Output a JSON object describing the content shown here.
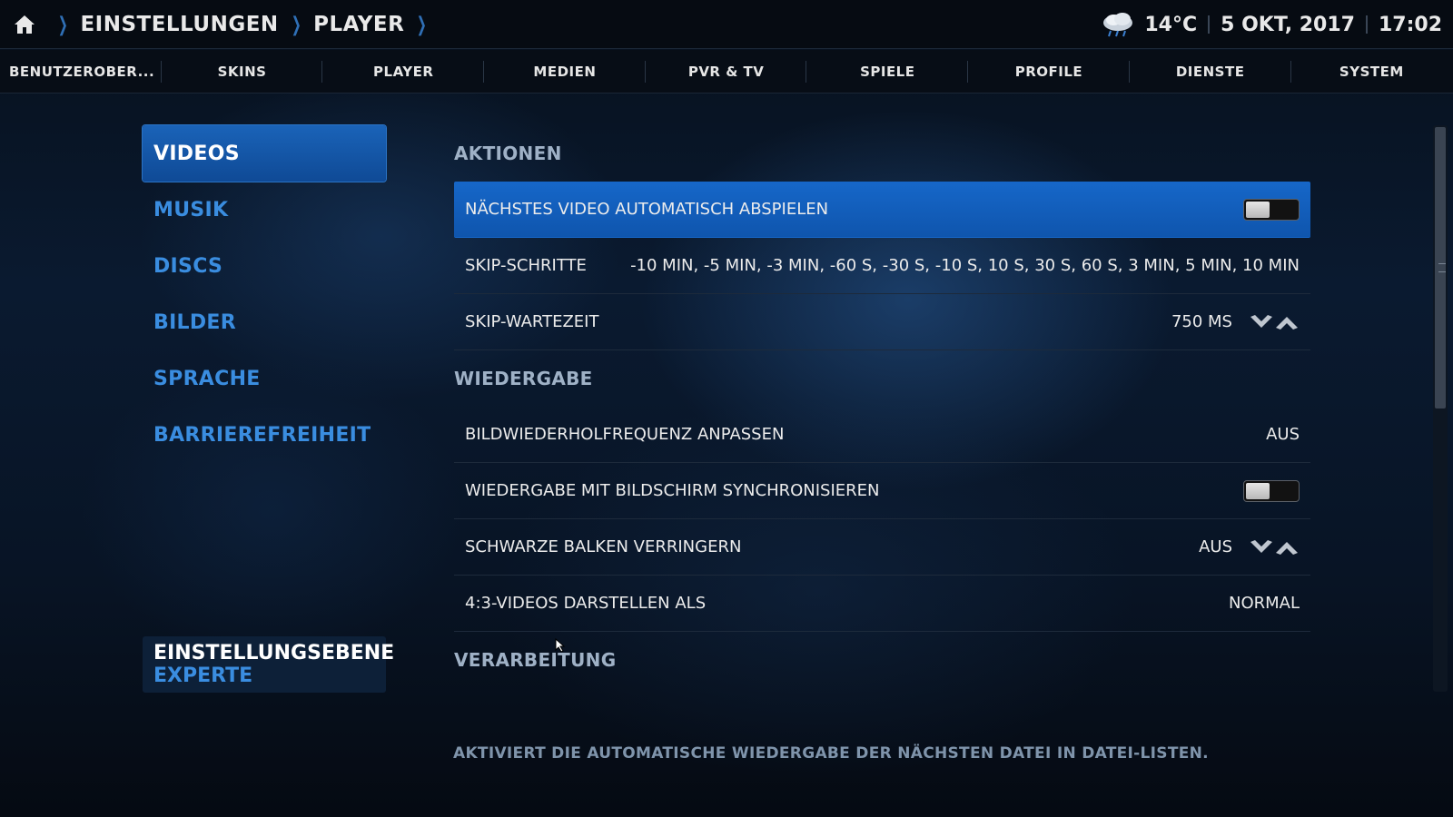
{
  "breadcrumb": {
    "items": [
      "EINSTELLUNGEN",
      "PLAYER"
    ]
  },
  "status": {
    "temperature": "14°C",
    "date": "5 OKT, 2017",
    "time": "17:02",
    "weather_icon": "cloudy-rain-icon"
  },
  "tabs": [
    {
      "label": "BENUTZEROBER..."
    },
    {
      "label": "SKINS"
    },
    {
      "label": "PLAYER"
    },
    {
      "label": "MEDIEN"
    },
    {
      "label": "PVR & TV"
    },
    {
      "label": "SPIELE"
    },
    {
      "label": "PROFILE"
    },
    {
      "label": "DIENSTE"
    },
    {
      "label": "SYSTEM"
    }
  ],
  "categories": [
    {
      "label": "VIDEOS",
      "active": true
    },
    {
      "label": "MUSIK"
    },
    {
      "label": "DISCS"
    },
    {
      "label": "BILDER"
    },
    {
      "label": "SPRACHE"
    },
    {
      "label": "BARRIEREFREIHEIT"
    }
  ],
  "settings_level": {
    "label": "EINSTELLUNGSEBENE",
    "value": "EXPERTE"
  },
  "sections": {
    "aktionen": "AKTIONEN",
    "wiedergabe": "WIEDERGABE",
    "verarbeitung": "VERARBEITUNG"
  },
  "rows": {
    "autoplay": {
      "label": "NÄCHSTES VIDEO AUTOMATISCH ABSPIELEN",
      "toggle_on": false
    },
    "skip_steps": {
      "label": "SKIP-SCHRITTE",
      "value": "-10 MIN, -5 MIN, -3 MIN, -60 S, -30 S, -10 S, 10 S, 30 S, 60 S, 3 MIN, 5 MIN, 10 MIN"
    },
    "skip_delay": {
      "label": "SKIP-WARTEZEIT",
      "value": "750 MS"
    },
    "refresh_rate": {
      "label": "BILDWIEDERHOLFREQUENZ ANPASSEN",
      "value": "AUS"
    },
    "sync_display": {
      "label": "WIEDERGABE MIT BILDSCHIRM SYNCHRONISIEREN",
      "toggle_on": false
    },
    "black_bars": {
      "label": "SCHWARZE BALKEN VERRINGERN",
      "value": "AUS"
    },
    "videos_43": {
      "label": "4:3-VIDEOS DARSTELLEN ALS",
      "value": "NORMAL"
    }
  },
  "hint": "AKTIVIERT DIE AUTOMATISCHE WIEDERGABE DER NÄCHSTEN DATEI IN DATEI-LISTEN.",
  "colors": {
    "accent": "#1667c9",
    "category_text": "#3a8de0",
    "section_header": "#9fb1c6"
  }
}
